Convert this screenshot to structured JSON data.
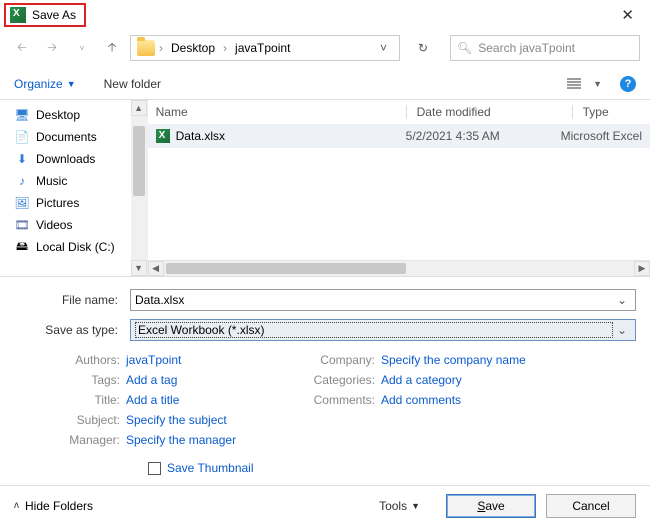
{
  "title": "Save As",
  "nav": {
    "crumb1": "Desktop",
    "crumb2": "javaTpoint",
    "search_placeholder": "Search javaTpoint"
  },
  "toolbar": {
    "organize": "Organize",
    "newfolder": "New folder"
  },
  "tree": {
    "desktop": "Desktop",
    "documents": "Documents",
    "downloads": "Downloads",
    "music": "Music",
    "pictures": "Pictures",
    "videos": "Videos",
    "localdisk": "Local Disk (C:)"
  },
  "cols": {
    "name": "Name",
    "date": "Date modified",
    "type": "Type"
  },
  "row": {
    "name": "Data.xlsx",
    "date": "5/2/2021 4:35 AM",
    "type": "Microsoft Excel"
  },
  "form": {
    "filename_label": "File name:",
    "filename_value": "Data.xlsx",
    "type_label": "Save as type:",
    "type_value": "Excel Workbook (*.xlsx)"
  },
  "meta": {
    "authors_l": "Authors:",
    "authors_v": "javaTpoint",
    "tags_l": "Tags:",
    "tags_v": "Add a tag",
    "title_l": "Title:",
    "title_v": "Add a title",
    "subject_l": "Subject:",
    "subject_v": "Specify the subject",
    "manager_l": "Manager:",
    "manager_v": "Specify the manager",
    "company_l": "Company:",
    "company_v": "Specify the company name",
    "categories_l": "Categories:",
    "categories_v": "Add a category",
    "comments_l": "Comments:",
    "comments_v": "Add comments"
  },
  "thumb": "Save Thumbnail",
  "footer": {
    "hide": "Hide Folders",
    "tools": "Tools",
    "save": "ave",
    "save_pre": "S",
    "cancel": "Cancel"
  }
}
